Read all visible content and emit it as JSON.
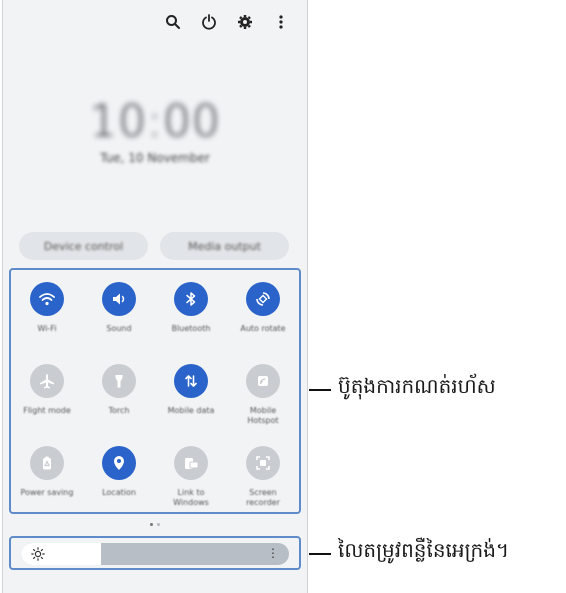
{
  "clock": {
    "time": "10:00",
    "date": "Tue, 10 November"
  },
  "pills": [
    {
      "label": "Device control"
    },
    {
      "label": "Media output"
    }
  ],
  "tiles": [
    {
      "label": "Wi-Fi",
      "icon": "wifi-icon",
      "active": true
    },
    {
      "label": "Sound",
      "icon": "sound-icon",
      "active": true
    },
    {
      "label": "Bluetooth",
      "icon": "bluetooth-icon",
      "active": true
    },
    {
      "label": "Auto rotate",
      "icon": "rotate-icon",
      "active": true
    },
    {
      "label": "Flight mode",
      "icon": "airplane-icon",
      "active": false
    },
    {
      "label": "Torch",
      "icon": "torch-icon",
      "active": false
    },
    {
      "label": "Mobile data",
      "icon": "data-icon",
      "active": true
    },
    {
      "label": "Mobile Hotspot",
      "icon": "hotspot-icon",
      "active": false
    },
    {
      "label": "Power saving",
      "icon": "battery-icon",
      "active": false
    },
    {
      "label": "Location",
      "icon": "location-icon",
      "active": true
    },
    {
      "label": "Link to Windows",
      "icon": "link-icon",
      "active": false
    },
    {
      "label": "Screen recorder",
      "icon": "screen-record-icon",
      "active": false
    }
  ],
  "brightness": {
    "level_percent": 30
  },
  "annotations": {
    "buttons": "ប៊ូតុងការកណត់រហ័ស",
    "brightness": "លៃតម្រូវពន្លឺនៃអេក្រង់។"
  },
  "colors": {
    "accent": "#2a63c9",
    "inactive": "#c9cdd2",
    "panel_bg": "#f2f3f5",
    "highlight_border": "#5f8bc9"
  }
}
